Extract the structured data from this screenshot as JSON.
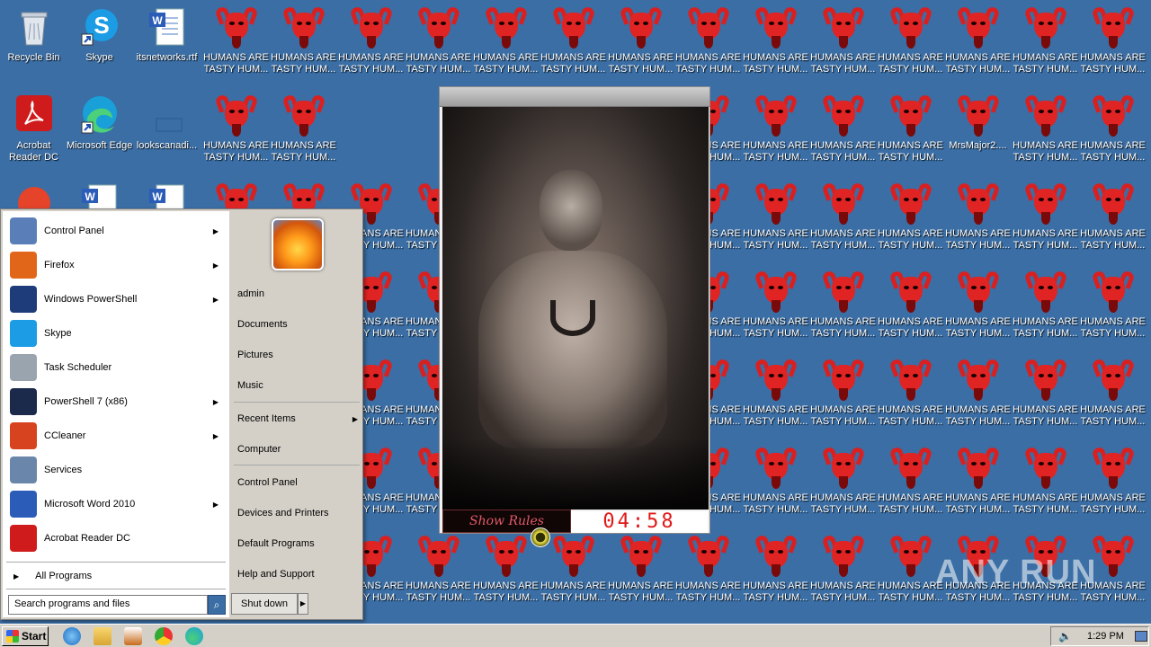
{
  "desktop": {
    "icons": [
      {
        "label": "Recycle Bin",
        "type": "recycle"
      },
      {
        "label": "Skype",
        "type": "skype"
      },
      {
        "label": "itsnetworks.rtf",
        "type": "word"
      },
      {
        "label": "Acrobat Reader DC",
        "type": "acrobat"
      },
      {
        "label": "Microsoft Edge",
        "type": "edge"
      },
      {
        "label": "lookscanadi...",
        "type": "file"
      }
    ],
    "devil_label": "HUMANS ARE TASTY HUM...",
    "devil_label_line1": "HUMANS ARE",
    "devil_label_line2": "TASTY HUM...",
    "special_label": "MrsMajor2...."
  },
  "window": {
    "show_rules_label": "Show Rules",
    "timer": "04:58"
  },
  "start_menu": {
    "programs": [
      {
        "label": "Control Panel",
        "has_submenu": true,
        "icon": "control-panel-icon"
      },
      {
        "label": "Firefox",
        "has_submenu": true,
        "icon": "firefox-icon"
      },
      {
        "label": "Windows PowerShell",
        "has_submenu": true,
        "icon": "powershell-icon"
      },
      {
        "label": "Skype",
        "has_submenu": false,
        "icon": "skype-icon"
      },
      {
        "label": "Task Scheduler",
        "has_submenu": false,
        "icon": "clock-icon"
      },
      {
        "label": "PowerShell 7 (x86)",
        "has_submenu": true,
        "icon": "powershell7-icon"
      },
      {
        "label": "CCleaner",
        "has_submenu": true,
        "icon": "ccleaner-icon"
      },
      {
        "label": "Services",
        "has_submenu": false,
        "icon": "gear-icon"
      },
      {
        "label": "Microsoft Word 2010",
        "has_submenu": true,
        "icon": "word-icon"
      },
      {
        "label": "Acrobat Reader DC",
        "has_submenu": false,
        "icon": "acrobat-icon"
      }
    ],
    "all_programs": "All Programs",
    "search_placeholder": "Search programs and files",
    "right_links": [
      {
        "label": "admin"
      },
      {
        "label": "Documents"
      },
      {
        "label": "Pictures"
      },
      {
        "label": "Music"
      },
      {
        "label": "Recent Items",
        "has_submenu": true
      },
      {
        "label": "Computer"
      },
      {
        "label": "Control Panel"
      },
      {
        "label": "Devices and Printers"
      },
      {
        "label": "Default Programs"
      },
      {
        "label": "Help and Support"
      }
    ],
    "shutdown_label": "Shut down"
  },
  "taskbar": {
    "start_label": "Start",
    "clock": "1:29 PM"
  },
  "watermark": "ANY RUN"
}
